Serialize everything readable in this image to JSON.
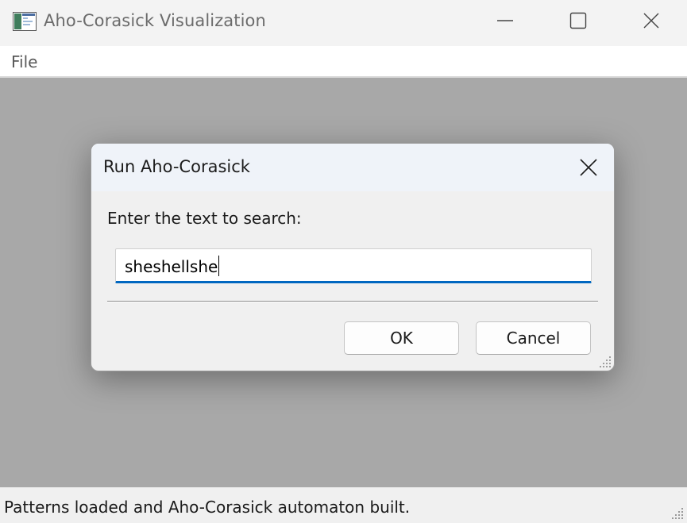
{
  "window": {
    "title": "Aho-Corasick Visualization",
    "icon": "app-window-icon",
    "controls": [
      "minimize-icon",
      "maximize-icon",
      "close-icon"
    ]
  },
  "menu": {
    "items": [
      {
        "label": "File"
      }
    ]
  },
  "status_bar": {
    "text": "Patterns loaded and Aho-Corasick automaton built."
  },
  "dialog": {
    "title": "Run Aho-Corasick",
    "prompt": "Enter the text to search:",
    "input_value": "sheshellshe",
    "ok_label": "OK",
    "cancel_label": "Cancel"
  },
  "colors": {
    "client_background": "#a8a8a8",
    "input_focus_accent": "#0067c0",
    "dialog_titlebar": "#eff3f9"
  }
}
